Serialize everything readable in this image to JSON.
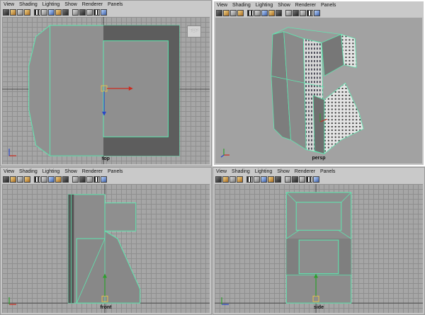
{
  "menu": [
    "View",
    "Shading",
    "Lighting",
    "Show",
    "Renderer",
    "Panels"
  ],
  "panels": {
    "top": {
      "camera": "top",
      "view_cube": "TOP"
    },
    "persp": {
      "camera": "persp"
    },
    "front": {
      "camera": "front"
    },
    "side": {
      "camera": "side"
    }
  },
  "colors": {
    "wireframe": "#5ee8b0",
    "grid_line": "#8f8f8f",
    "mesh_gray": "#8c8c8c",
    "x_axis": "#cc2a1e",
    "y_axis": "#2ca02c",
    "z_axis": "#2747c8"
  },
  "toolbar_icons": [
    "camera-icon",
    "film-icon",
    "grid-icon",
    "bookmark-icon",
    "lock-icon",
    "wireframe-icon",
    "smooth-shade-icon",
    "texture-icon",
    "lights-icon",
    "shadows-icon",
    "xray-icon",
    "isolate-icon",
    "resolution-gate-icon",
    "film-gate-icon",
    "safe-action-icon"
  ]
}
